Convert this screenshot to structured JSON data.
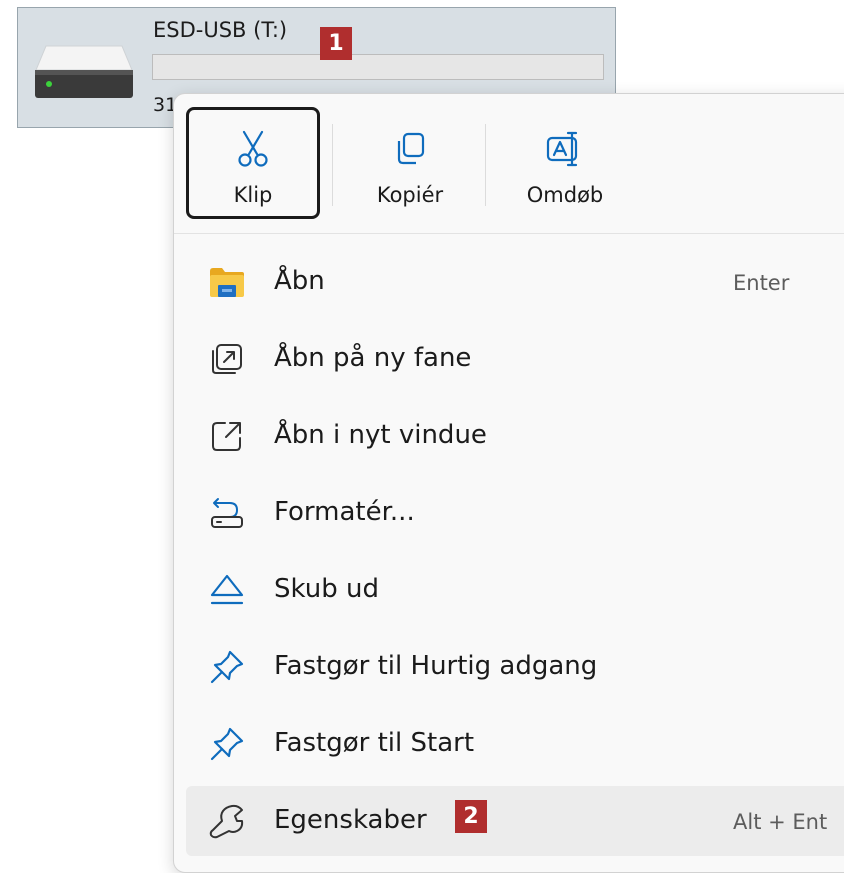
{
  "drive": {
    "name": "ESD-USB (T:)",
    "size_text": "31",
    "usage_fraction": 0.0
  },
  "callouts": {
    "one": "1",
    "two": "2"
  },
  "quick_actions": [
    {
      "label": "Klip",
      "icon": "scissors-icon"
    },
    {
      "label": "Kopiér",
      "icon": "copy-icon"
    },
    {
      "label": "Omdøb",
      "icon": "rename-icon"
    }
  ],
  "menu": {
    "items": [
      {
        "label": "Åbn",
        "shortcut": "Enter",
        "icon": "folder-icon"
      },
      {
        "label": "Åbn på ny fane",
        "shortcut": "",
        "icon": "open-new-tab-icon"
      },
      {
        "label": "Åbn i nyt vindue",
        "shortcut": "",
        "icon": "open-new-window-icon"
      },
      {
        "label": "Formatér...",
        "shortcut": "",
        "icon": "format-icon"
      },
      {
        "label": "Skub ud",
        "shortcut": "",
        "icon": "eject-icon"
      },
      {
        "label": "Fastgør til Hurtig adgang",
        "shortcut": "",
        "icon": "pin-icon"
      },
      {
        "label": "Fastgør til Start",
        "shortcut": "",
        "icon": "pin-icon"
      },
      {
        "label": "Egenskaber",
        "shortcut": "Alt + Ent",
        "icon": "wrench-icon"
      }
    ]
  },
  "colors": {
    "accent": "#0f6cbd",
    "callout": "#b02e2e",
    "folder": "#f2c94c"
  }
}
